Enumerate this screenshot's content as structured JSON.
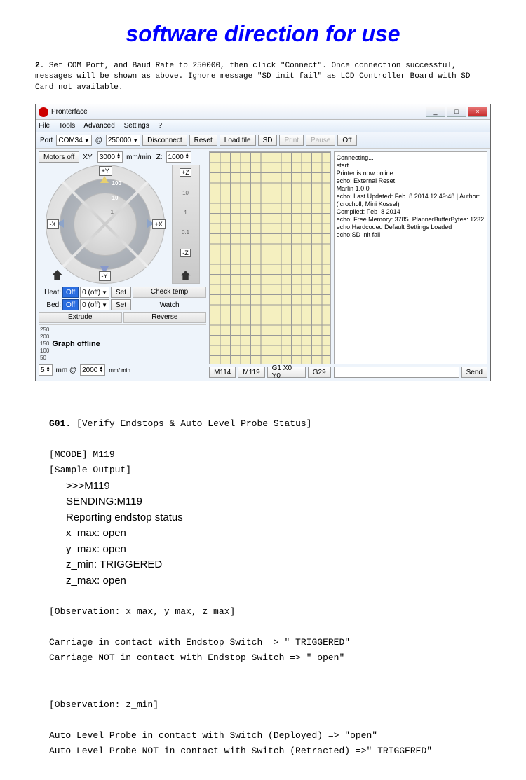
{
  "title": "software direction for use",
  "step": "2.",
  "instruction": "Set COM Port, and Baud Rate to 250000, then click \"Connect\". Once connection successful, messages will be shown as above. Ignore message \"SD init fail\" as LCD Controller Board with SD Card not available.",
  "window": {
    "title": "Pronterface",
    "min": "_",
    "max": "□",
    "close": "×",
    "menu": {
      "file": "File",
      "tools": "Tools",
      "advanced": "Advanced",
      "settings": "Settings",
      "help": "?"
    },
    "toolbar": {
      "port_label": "Port",
      "port_value": "COM34",
      "at": "@",
      "baud": "250000",
      "disconnect": "Disconnect",
      "reset": "Reset",
      "loadfile": "Load file",
      "sd": "SD",
      "print": "Print",
      "pause": "Pause",
      "off": "Off"
    },
    "row2": {
      "motors_off": "Motors off",
      "xy_label": "XY:",
      "xy_value": "3000",
      "mmmin": "mm/min",
      "z_label": "Z:",
      "z_value": "1000"
    },
    "jog": {
      "px": "+X",
      "nx": "-X",
      "py": "+Y",
      "ny": "-Y",
      "pz": "+Z",
      "nz": "-Z",
      "n100": "100",
      "n10": "10",
      "n1": "1",
      "n01": "0.1"
    },
    "heat": {
      "heat_label": "Heat:",
      "bed_label": "Bed:",
      "off": "Off",
      "heat_value": "0 (off)",
      "bed_value": "0 (off)",
      "set": "Set",
      "checktemp": "Check temp",
      "watch": "Watch"
    },
    "ext": {
      "extrude": "Extrude",
      "reverse": "Reverse",
      "len": "5",
      "mm_at": "mm @",
      "speed": "2000",
      "mmmin": "mm/\nmin"
    },
    "graph": {
      "t250": "250",
      "t200": "200",
      "t150": "150",
      "t100": "100",
      "t50": "50",
      "offline": "Graph offline"
    },
    "macros": {
      "m114": "M114",
      "m119": "M119",
      "g1": "G1 X0 Y0",
      "g29": "G29"
    },
    "console": "Connecting...\nstart\nPrinter is now online.\necho: External Reset\nMarlin 1.0.0\necho: Last Updated: Feb  8 2014 12:49:48 | Author: (jcrocholl, Mini Kossel)\nCompiled: Feb  8 2014\necho: Free Memory: 3785  PlannerBufferBytes: 1232\necho:Hardcoded Default Settings Loaded\necho:SD init fail",
    "send": "Send"
  },
  "doc": {
    "g01": "G01.",
    "g01_title": "[Verify Endstops & Auto Level Probe Status]",
    "mcode": "[MCODE] M119",
    "sample": "[Sample Output]",
    "out": [
      ">>>M119",
      "SENDING:M119",
      "Reporting endstop status",
      "x_max: open",
      "y_max: open",
      "z_min: TRIGGERED",
      "z_max: open"
    ],
    "obs1": "[Observation: x_max, y_max, z_max]",
    "obs1_l1": "Carriage in contact with Endstop Switch => \" TRIGGERED\"",
    "obs1_l2": "Carriage NOT in contact with Endstop Switch => \" open\"",
    "obs2": "[Observation: z_min]",
    "obs2_l1": "Auto Level Probe in contact with Switch (Deployed) => \"open\"",
    "obs2_l2": "Auto Level Probe NOT in contact with Switch (Retracted) =>\" TRIGGERED\""
  }
}
